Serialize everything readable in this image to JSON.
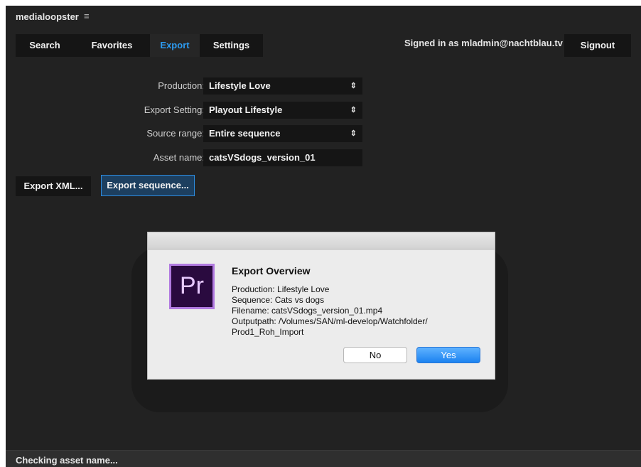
{
  "app": {
    "title": "medialoopster",
    "menu_icon": "≡",
    "accent_color": "#2d9bf0"
  },
  "tabs": [
    {
      "label": "Search"
    },
    {
      "label": "Favorites"
    },
    {
      "label": "Export"
    },
    {
      "label": "Settings"
    }
  ],
  "active_tab": "Export",
  "user": {
    "signed_in_text": "Signed in as mladmin@nachtblau.tv",
    "signout_label": "Signout"
  },
  "form": {
    "production": {
      "label": "Production:",
      "value": "Lifestyle Love"
    },
    "export_setting": {
      "label": "Export Setting:",
      "value": "Playout Lifestyle"
    },
    "source_range": {
      "label": "Source range:",
      "value": "Entire sequence"
    },
    "asset_name": {
      "label": "Asset name:",
      "value": "catsVSdogs_version_01"
    },
    "select_arrow": "↕"
  },
  "buttons": {
    "export_xml": "Export XML...",
    "export_sequence": "Export sequence..."
  },
  "dialog": {
    "icon_text": "Pr",
    "icon_name": "premiere-pro-icon",
    "title": "Export Overview",
    "lines": [
      "Production: Lifestyle Love",
      "Sequence: Cats vs dogs",
      "Filename: catsVSdogs_version_01.mp4",
      "Outputpath: /Volumes/SAN/ml-develop/Watchfolder/",
      "Prod1_Roh_Import"
    ],
    "no_label": "No",
    "yes_label": "Yes"
  },
  "status": {
    "text": "Checking asset name..."
  }
}
